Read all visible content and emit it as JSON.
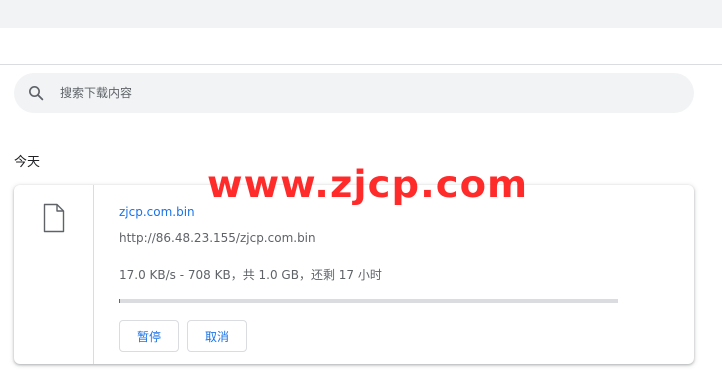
{
  "search": {
    "placeholder": "搜索下载内容"
  },
  "date_header": "今天",
  "download": {
    "file_name": "zjcp.com.bin",
    "url": "http://86.48.23.155/zjcp.com.bin",
    "status": "17.0 KB/s - 708 KB，共 1.0 GB，还剩 17 小时",
    "progress_fraction": 0.0007,
    "pause_label": "暂停",
    "cancel_label": "取消",
    "icon": "file-icon"
  },
  "watermark": "www.zjcp.com",
  "colors": {
    "link": "#1a73e8",
    "watermark": "#ff1a1a",
    "search_bg": "#f1f3f4"
  }
}
